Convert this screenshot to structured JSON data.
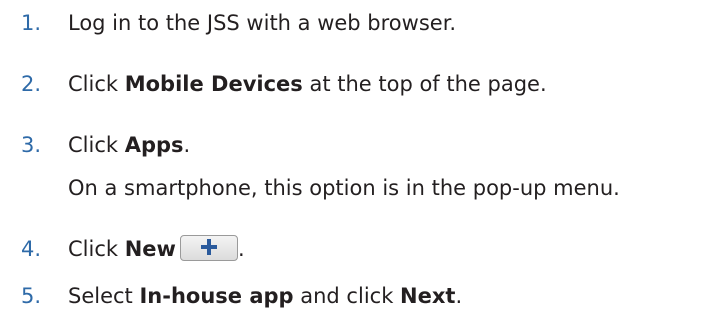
{
  "steps": [
    {
      "number": "1.",
      "parts": [
        "Log in to the JSS with a web browser."
      ]
    },
    {
      "number": "2.",
      "parts": [
        "Click ",
        "Mobile Devices",
        " at the top of the page."
      ]
    },
    {
      "number": "3.",
      "parts": [
        "Click ",
        "Apps",
        "."
      ],
      "note": "On a smartphone, this option is in the pop-up menu."
    },
    {
      "number": "4.",
      "parts": [
        "Click ",
        "New",
        "."
      ],
      "button_icon": "plus-icon"
    },
    {
      "number": "5.",
      "parts": [
        "Select ",
        "In-house app",
        " and click ",
        "Next",
        "."
      ]
    }
  ],
  "colors": {
    "number": "#2e6aa8",
    "text": "#231f20",
    "plus": "#2a5a9c"
  }
}
